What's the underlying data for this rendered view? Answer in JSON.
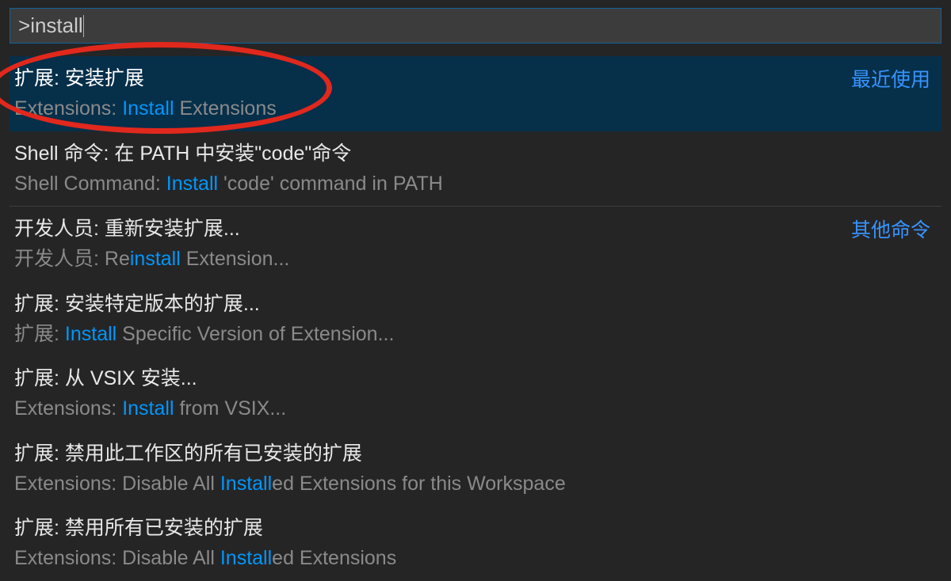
{
  "input": {
    "prefix": ">",
    "value": "install"
  },
  "tags": {
    "recent": "最近使用",
    "other": "其他命令"
  },
  "highlight_word": "install",
  "highlight_word2": "Install",
  "highlight_word3": "Installed",
  "results": [
    {
      "title": "扩展: 安装扩展",
      "subtitle_pre": "Extensions: ",
      "subtitle_hl": "Install",
      "subtitle_post": " Extensions",
      "selected": true,
      "tag": "recent"
    },
    {
      "title": "Shell 命令: 在 PATH 中安装\"code\"命令",
      "subtitle_pre": "Shell Command: ",
      "subtitle_hl": "Install",
      "subtitle_post": " 'code' command in PATH",
      "selected": false,
      "tag": null
    },
    {
      "title": "开发人员: 重新安装扩展...",
      "subtitle_pre": "开发人员: Re",
      "subtitle_hl": "install",
      "subtitle_post": " Extension...",
      "selected": false,
      "tag": "other",
      "divider": true
    },
    {
      "title": "扩展: 安装特定版本的扩展...",
      "subtitle_pre": "扩展: ",
      "subtitle_hl": "Install",
      "subtitle_post": " Specific Version of Extension...",
      "selected": false,
      "tag": null
    },
    {
      "title": "扩展: 从 VSIX 安装...",
      "subtitle_pre": "Extensions: ",
      "subtitle_hl": "Install",
      "subtitle_post": " from VSIX...",
      "selected": false,
      "tag": null
    },
    {
      "title": "扩展: 禁用此工作区的所有已安装的扩展",
      "subtitle_pre": "Extensions: Disable All ",
      "subtitle_hl": "Install",
      "subtitle_post": "ed Extensions for this Workspace",
      "selected": false,
      "tag": null
    },
    {
      "title": "扩展: 禁用所有已安装的扩展",
      "subtitle_pre": "Extensions: Disable All ",
      "subtitle_hl": "Install",
      "subtitle_post": "ed Extensions",
      "selected": false,
      "tag": null
    }
  ]
}
